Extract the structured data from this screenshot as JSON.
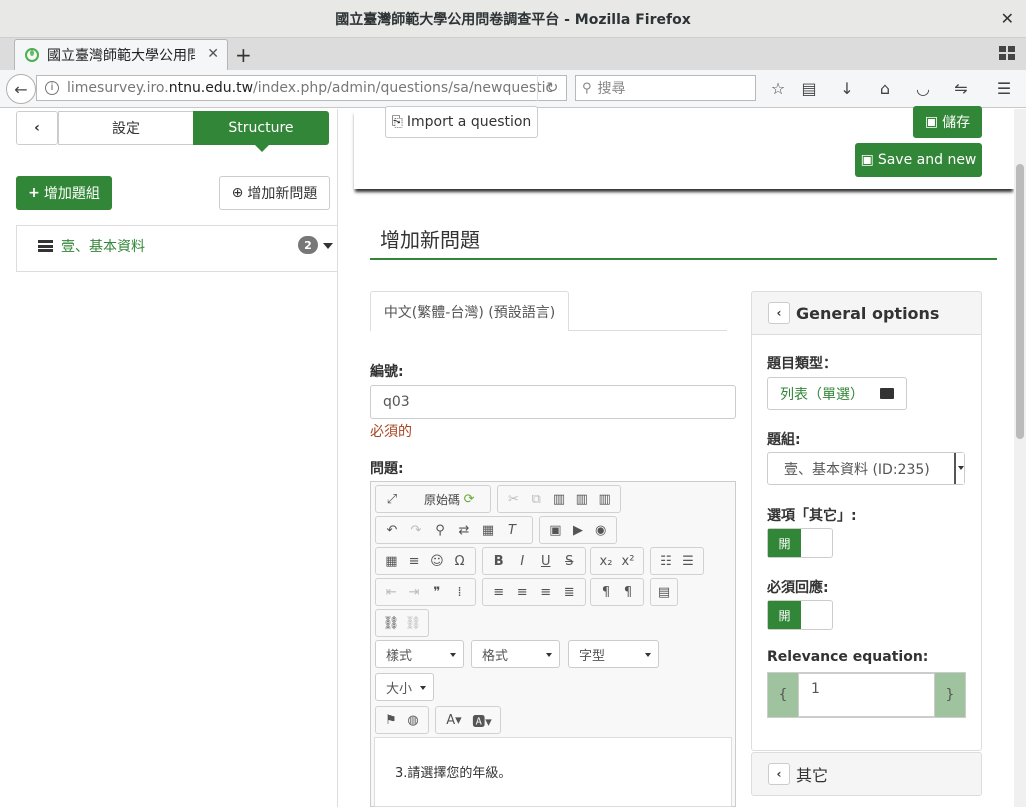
{
  "window": {
    "title": "國立臺灣師範大學公用問卷調查平台 - Mozilla Firefox",
    "close_glyph": "✕"
  },
  "browser": {
    "tab_title": "國立臺灣師範大學公用問卷調查平台",
    "tab_close": "✕",
    "newtab": "+",
    "url_prefix": "limesurvey.iro.",
    "url_domain": "ntnu.edu.tw",
    "url_path": "/index.php/admin/questions/sa/newquestic",
    "search_placeholder": "搜尋",
    "back_glyph": "←",
    "reload_glyph": "↻"
  },
  "sidebar": {
    "back": "‹",
    "tab_settings": "設定",
    "tab_structure": "Structure",
    "add_group": "增加題組",
    "add_question": "增加新問題",
    "group_name": "壹、基本資料",
    "group_count": "2"
  },
  "main": {
    "import_label": "Import a question",
    "save_label": "儲存",
    "save_new_label": "Save and new",
    "page_title": "增加新問題",
    "lang_tab": "中文(繁體-台灣) (預設語言)",
    "code_label": "編號:",
    "code_value": "q03",
    "required_text": "必須的",
    "question_label": "問題:",
    "editor": {
      "source_label": "原始碼",
      "combo_styles": "樣式",
      "combo_format": "格式",
      "combo_font": "字型",
      "combo_size": "大小",
      "content": "3.請選擇您的年級。"
    }
  },
  "panel": {
    "title": "General options",
    "qtype_label": "題目類型：",
    "qtype_value": "列表（單選）",
    "group_label": "題組:",
    "group_value": "壹、基本資料 (ID:235)",
    "other_label": "選項「其它」:",
    "other_toggle": "開",
    "mandatory_label": "必須回應:",
    "mandatory_toggle": "開",
    "relevance_label": "Relevance equation:",
    "relevance_open": "{",
    "relevance_value": "1",
    "relevance_close": "}",
    "other_section": "其它"
  },
  "colors": {
    "accent": "#328637",
    "required": "#a94420"
  }
}
